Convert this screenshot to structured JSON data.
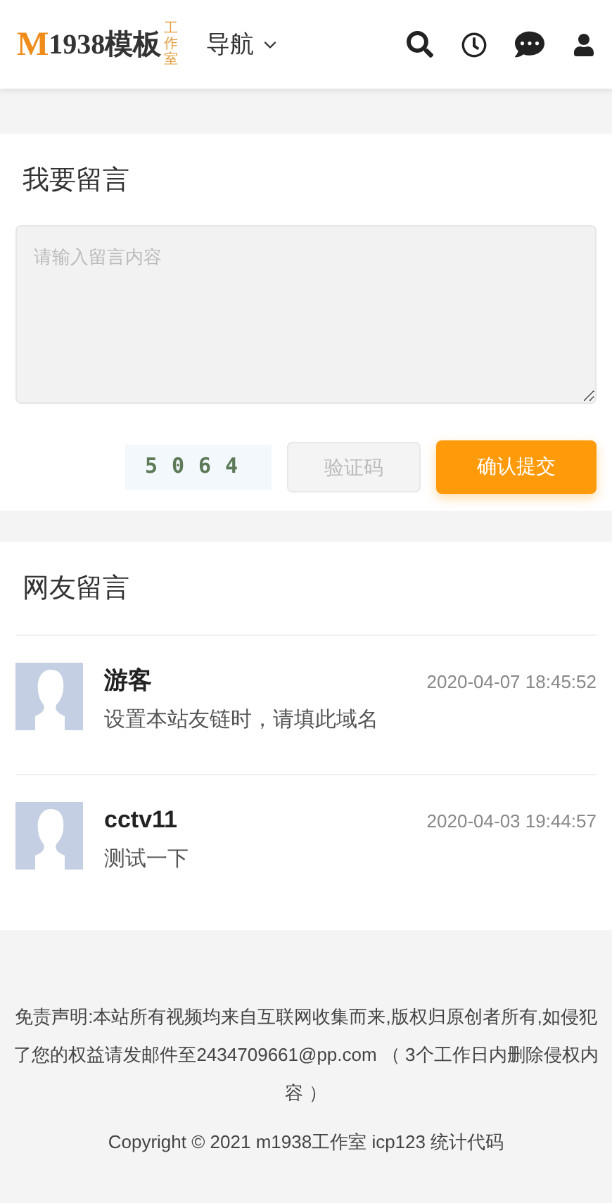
{
  "header": {
    "logo": {
      "letter": "M",
      "name": "1938模板",
      "studio": "工作室"
    },
    "nav": {
      "label": "导航"
    }
  },
  "form": {
    "title": "我要留言",
    "message": {
      "placeholder": "请输入留言内容"
    },
    "captcha": "5064",
    "code": {
      "placeholder": "验证码"
    },
    "submit": "确认提交"
  },
  "comments": {
    "title": "网友留言",
    "items": [
      {
        "author": "游客",
        "time": "2020-04-07 18:45:52",
        "text": "设置本站友链时，请填此域名"
      },
      {
        "author": "cctv11",
        "time": "2020-04-03 19:44:57",
        "text": "测试一下"
      }
    ]
  },
  "footer": {
    "disclaimer": "免责声明:本站所有视频均来自互联网收集而来,版权归原创者所有,如侵犯了您的权益请发邮件至2434709661@pp.com （ 3个工作日内删除侵权内容 ）",
    "copyright": "Copyright © 2021 m1938工作室 icp123 统计代码"
  }
}
